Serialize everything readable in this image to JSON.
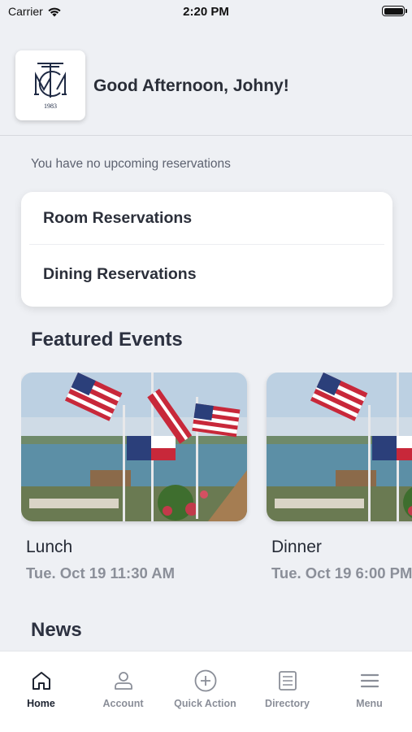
{
  "status_bar": {
    "carrier": "Carrier",
    "time": "2:20 PM",
    "wifi_icon": "wifi-icon",
    "battery_icon": "battery-icon"
  },
  "header": {
    "logo_year": "1983",
    "greeting": "Good Afternoon, Johny!"
  },
  "reservations": {
    "empty_message": "You have no upcoming reservations",
    "items": [
      {
        "label": "Room Reservations"
      },
      {
        "label": "Dining Reservations"
      }
    ]
  },
  "featured_events": {
    "title": "Featured Events",
    "items": [
      {
        "name": "Lunch",
        "date": "Tue. Oct 19 11:30 AM"
      },
      {
        "name": "Dinner",
        "date": "Tue. Oct 19 6:00 PM"
      }
    ]
  },
  "news": {
    "title": "News"
  },
  "tab_bar": {
    "items": [
      {
        "label": "Home",
        "icon": "home-icon",
        "active": true
      },
      {
        "label": "Account",
        "icon": "account-icon",
        "active": false
      },
      {
        "label": "Quick Action",
        "icon": "plus-circle-icon",
        "active": false
      },
      {
        "label": "Directory",
        "icon": "directory-icon",
        "active": false
      },
      {
        "label": "Menu",
        "icon": "menu-icon",
        "active": false
      }
    ]
  },
  "colors": {
    "background": "#eef0f4",
    "card": "#ffffff",
    "text_primary": "#2b2f3a",
    "text_secondary": "#8b8f99",
    "tab_active": "#1d2330",
    "tab_inactive": "#8a8e98"
  }
}
